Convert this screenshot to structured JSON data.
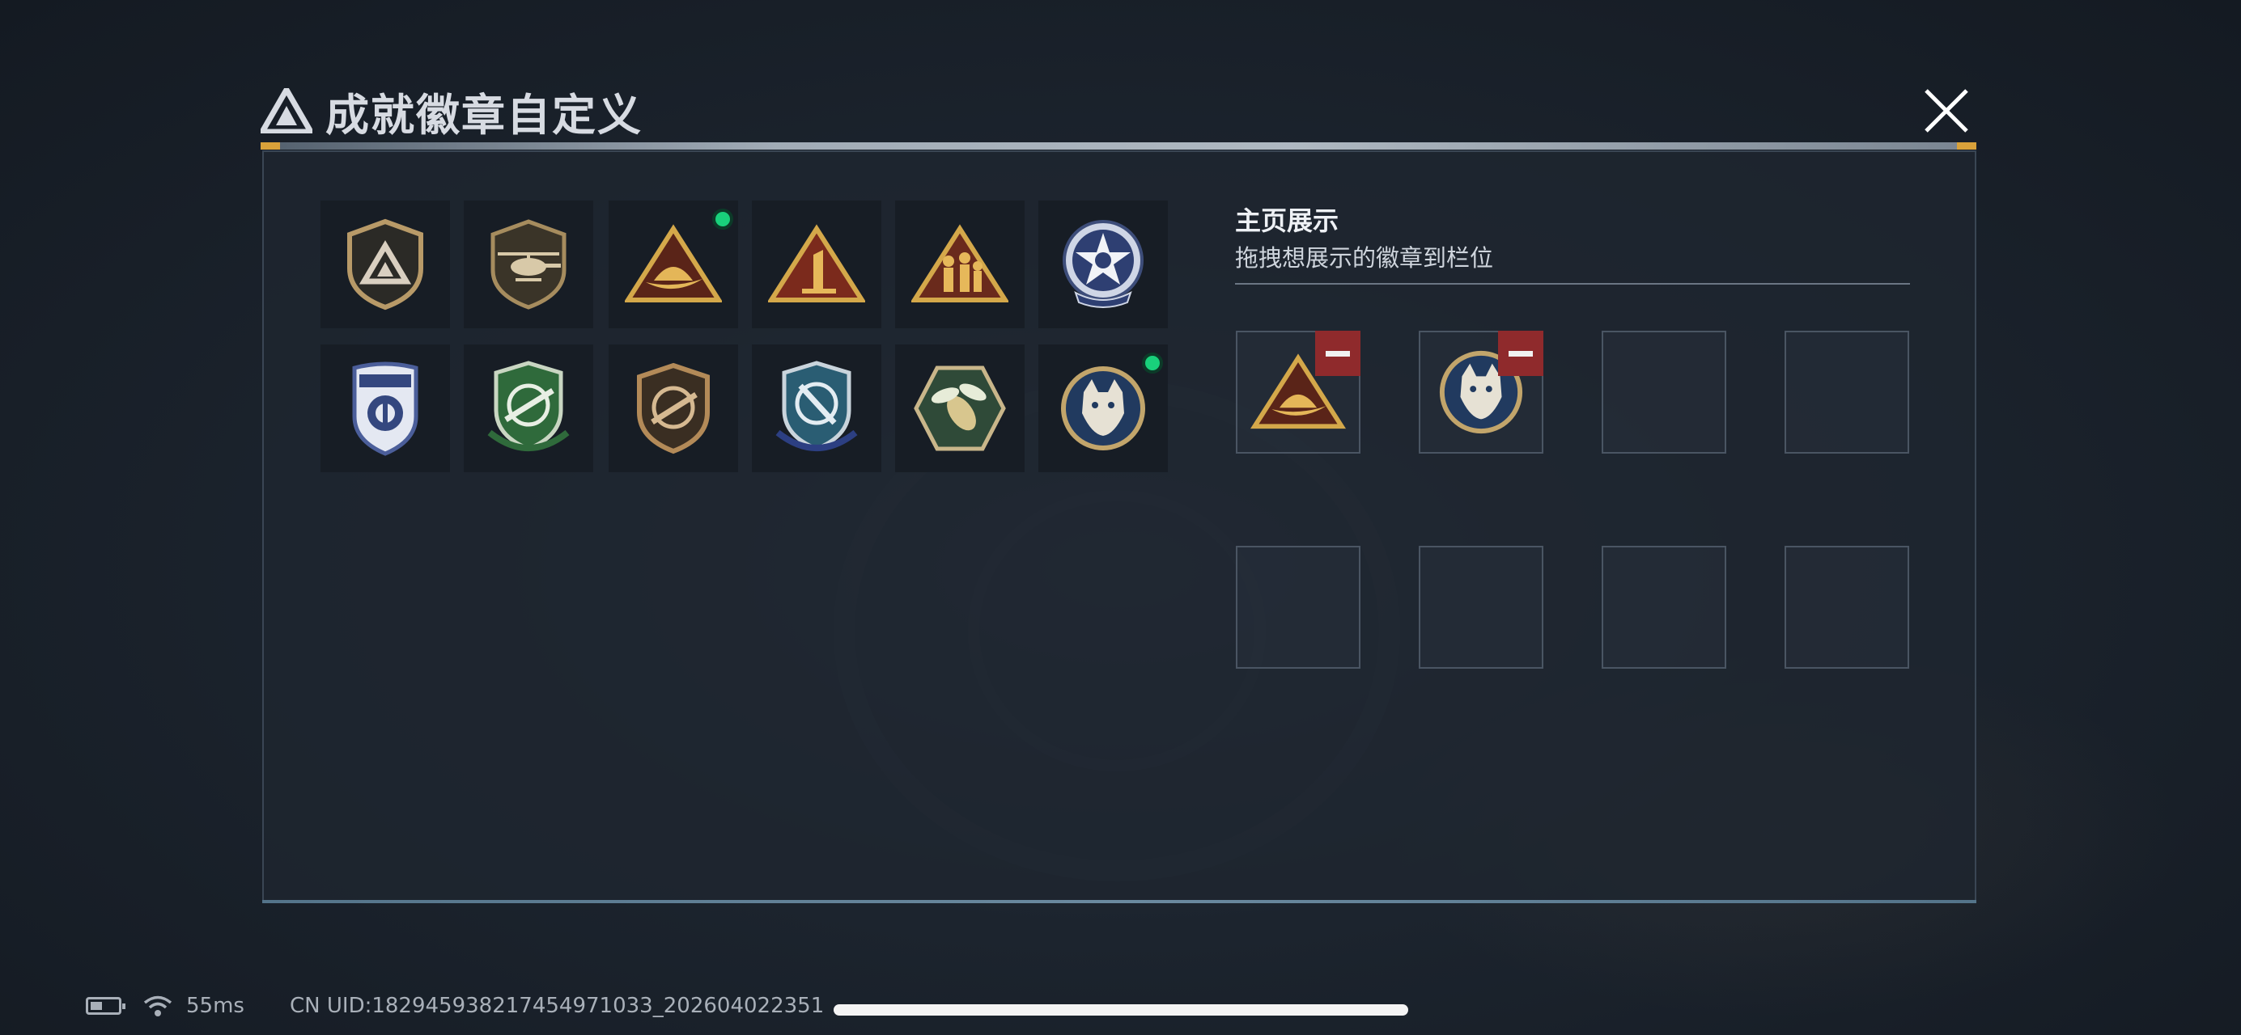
{
  "window": {
    "title": "成就徽章自定义",
    "close_icon": "close-icon",
    "logo_icon": "triangle-logo-icon"
  },
  "badges": [
    {
      "name": "triangle-shield-badge",
      "new": false
    },
    {
      "name": "helicopter-badge",
      "new": false
    },
    {
      "name": "hardhat-triangle-badge",
      "new": true
    },
    {
      "name": "number-one-triangle-badge",
      "new": false
    },
    {
      "name": "soldiers-triangle-badge",
      "new": false
    },
    {
      "name": "star-skull-badge",
      "new": false
    },
    {
      "name": "blue-police-badge",
      "new": false
    },
    {
      "name": "green-rifle-badge",
      "new": false
    },
    {
      "name": "bronze-rifle-badge",
      "new": false
    },
    {
      "name": "blue-sniper-badge",
      "new": false
    },
    {
      "name": "green-wasp-badge",
      "new": false
    },
    {
      "name": "wolf-medal-badge",
      "new": true
    }
  ],
  "showcase": {
    "title": "主页展示",
    "subtitle": "拖拽想展示的徽章到栏位",
    "slots": [
      {
        "badge": "hardhat-triangle-badge",
        "remove_icon": "minus-icon"
      },
      {
        "badge": "wolf-medal-badge",
        "remove_icon": "minus-icon"
      },
      {
        "badge": null
      },
      {
        "badge": null
      },
      {
        "badge": null
      },
      {
        "badge": null
      },
      {
        "badge": null
      },
      {
        "badge": null
      }
    ]
  },
  "status_bar": {
    "battery_icon": "battery-icon",
    "wifi_icon": "wifi-icon",
    "ping": "55ms",
    "uid": "CN UID:1829459382174549710​33_202604022351"
  },
  "colors": {
    "accent_gold": "#d9a13a",
    "new_dot": "#19d07b",
    "remove_red": "#8f2a2c",
    "panel_bg": "#1e2630"
  }
}
